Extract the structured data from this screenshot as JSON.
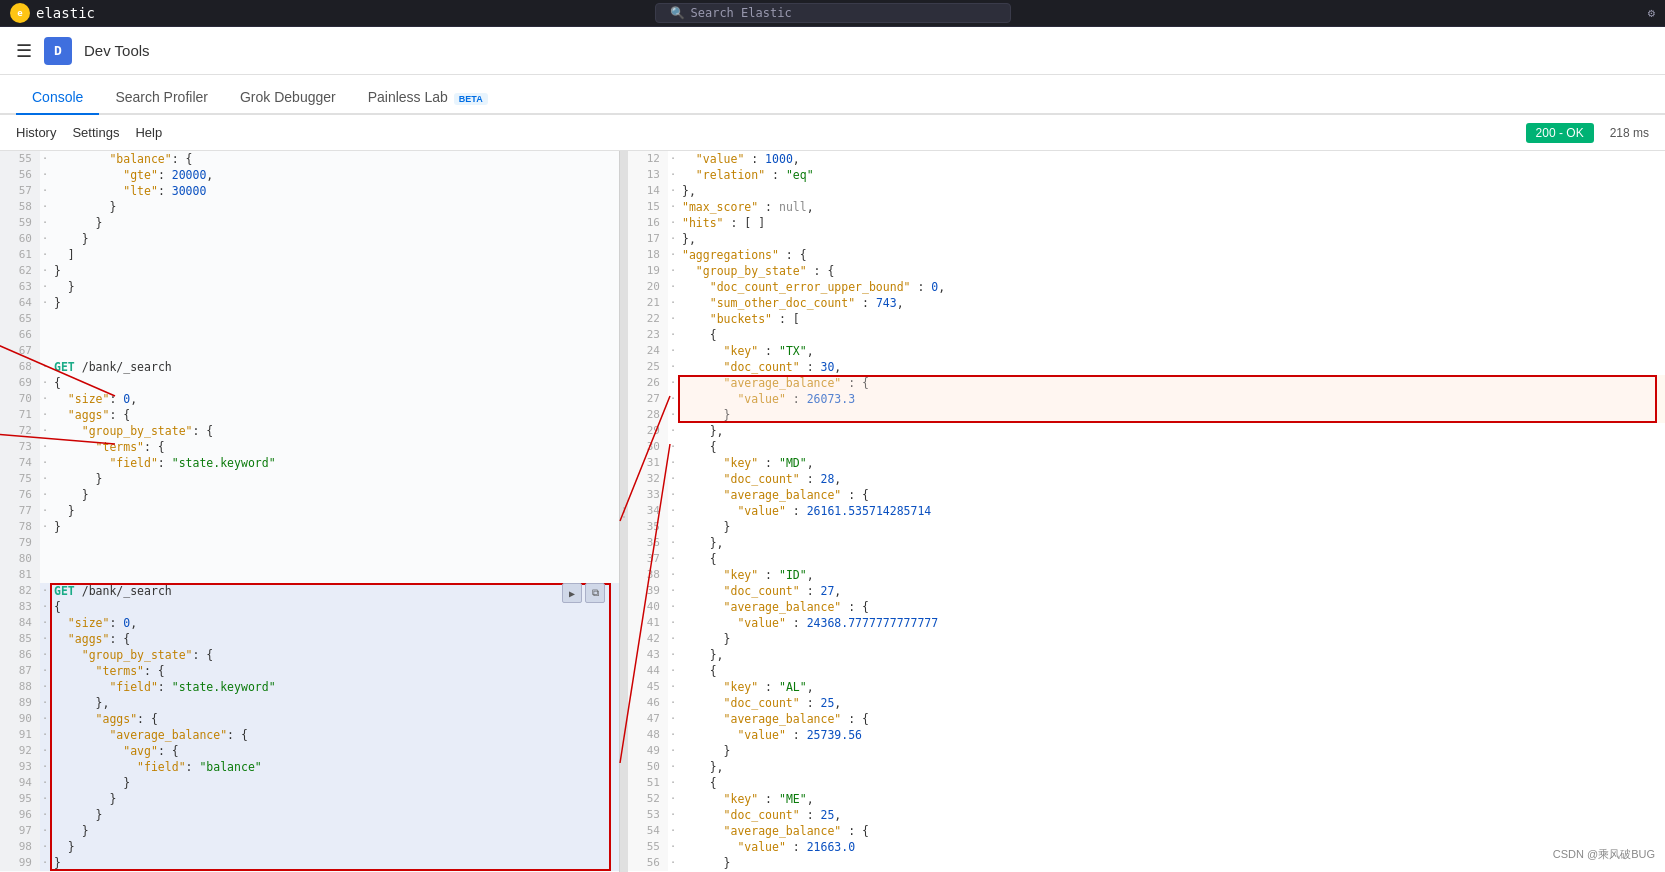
{
  "topbar": {
    "search_placeholder": "Search Elastic",
    "app_name": "elastic"
  },
  "appbar": {
    "app_icon_letter": "D",
    "app_title": "Dev Tools"
  },
  "tabs": [
    {
      "id": "console",
      "label": "Console",
      "active": true,
      "beta": false
    },
    {
      "id": "search-profiler",
      "label": "Search Profiler",
      "active": false,
      "beta": false
    },
    {
      "id": "grok-debugger",
      "label": "Grok Debugger",
      "active": false,
      "beta": false
    },
    {
      "id": "painless-lab",
      "label": "Painless Lab",
      "active": false,
      "beta": true
    }
  ],
  "menubar": {
    "history": "History",
    "settings": "Settings",
    "help": "Help",
    "status": "200 - OK",
    "size": "218 ms"
  },
  "editor": {
    "lines": [
      {
        "num": "55",
        "content": "        \"balance\": {"
      },
      {
        "num": "56",
        "content": "          \"gte\": 20000,"
      },
      {
        "num": "57",
        "content": "          \"lte\": 30000"
      },
      {
        "num": "58",
        "content": "        }"
      },
      {
        "num": "59",
        "content": "      }"
      },
      {
        "num": "60",
        "content": "    }"
      },
      {
        "num": "61",
        "content": "  ]"
      },
      {
        "num": "62",
        "content": "}"
      },
      {
        "num": "63",
        "content": "  }"
      },
      {
        "num": "64",
        "content": "}"
      },
      {
        "num": "65",
        "content": ""
      },
      {
        "num": "66",
        "content": ""
      },
      {
        "num": "67",
        "content": ""
      },
      {
        "num": "68",
        "content": "GET /bank/_search",
        "isGet": true
      },
      {
        "num": "69",
        "content": "{"
      },
      {
        "num": "70",
        "content": "  \"size\": 0,"
      },
      {
        "num": "71",
        "content": "  \"aggs\": {"
      },
      {
        "num": "72",
        "content": "    \"group_by_state\": {"
      },
      {
        "num": "73",
        "content": "      \"terms\": {"
      },
      {
        "num": "74",
        "content": "        \"field\": \"state.keyword\""
      },
      {
        "num": "75",
        "content": "      }"
      },
      {
        "num": "76",
        "content": "    }"
      },
      {
        "num": "77",
        "content": "  }"
      },
      {
        "num": "78",
        "content": "}"
      },
      {
        "num": "79",
        "content": ""
      },
      {
        "num": "80",
        "content": ""
      },
      {
        "num": "81",
        "content": ""
      },
      {
        "num": "82",
        "content": "GET /bank/_search",
        "isGet": true,
        "highlighted": true
      },
      {
        "num": "83",
        "content": "{",
        "highlighted": true
      },
      {
        "num": "84",
        "content": "  \"size\": 0,",
        "highlighted": true
      },
      {
        "num": "85",
        "content": "  \"aggs\": {",
        "highlighted": true
      },
      {
        "num": "86",
        "content": "    \"group_by_state\": {",
        "highlighted": true
      },
      {
        "num": "87",
        "content": "      \"terms\": {",
        "highlighted": true
      },
      {
        "num": "88",
        "content": "        \"field\": \"state.keyword\"",
        "highlighted": true
      },
      {
        "num": "89",
        "content": "      },",
        "highlighted": true
      },
      {
        "num": "90",
        "content": "      \"aggs\": {",
        "highlighted": true
      },
      {
        "num": "91",
        "content": "        \"average_balance\": {",
        "highlighted": true
      },
      {
        "num": "92",
        "content": "          \"avg\": {",
        "highlighted": true
      },
      {
        "num": "93",
        "content": "            \"field\": \"balance\"",
        "highlighted": true
      },
      {
        "num": "94",
        "content": "          }"
      },
      {
        "num": "95",
        "content": "        }"
      },
      {
        "num": "96",
        "content": "      }"
      },
      {
        "num": "97",
        "content": "    }"
      },
      {
        "num": "98",
        "content": "  }"
      },
      {
        "num": "99",
        "content": "}"
      }
    ]
  },
  "response": {
    "lines": [
      {
        "num": "12",
        "content": "  \"value\" : 1000,"
      },
      {
        "num": "13",
        "content": "  \"relation\" : \"eq\""
      },
      {
        "num": "14",
        "content": "},"
      },
      {
        "num": "15",
        "content": "\"max_score\" : null,"
      },
      {
        "num": "16",
        "content": "\"hits\" : [ ]"
      },
      {
        "num": "17",
        "content": "},"
      },
      {
        "num": "18",
        "content": "\"aggregations\" : {"
      },
      {
        "num": "19",
        "content": "  \"group_by_state\" : {"
      },
      {
        "num": "20",
        "content": "    \"doc_count_error_upper_bound\" : 0,"
      },
      {
        "num": "21",
        "content": "    \"sum_other_doc_count\" : 743,"
      },
      {
        "num": "22",
        "content": "    \"buckets\" : ["
      },
      {
        "num": "23",
        "content": "    {"
      },
      {
        "num": "24",
        "content": "      \"key\" : \"TX\","
      },
      {
        "num": "25",
        "content": "      \"doc_count\" : 30,"
      },
      {
        "num": "26",
        "content": "      \"average_balance\" : {",
        "highlighted": true
      },
      {
        "num": "27",
        "content": "        \"value\" : 26073.3",
        "highlighted": true
      },
      {
        "num": "28",
        "content": "      }",
        "highlighted": true
      },
      {
        "num": "29",
        "content": "    },"
      },
      {
        "num": "30",
        "content": "    {"
      },
      {
        "num": "31",
        "content": "      \"key\" : \"MD\","
      },
      {
        "num": "32",
        "content": "      \"doc_count\" : 28,"
      },
      {
        "num": "33",
        "content": "      \"average_balance\" : {"
      },
      {
        "num": "34",
        "content": "        \"value\" : 26161.535714285714"
      },
      {
        "num": "35",
        "content": "      }"
      },
      {
        "num": "36",
        "content": "    },"
      },
      {
        "num": "37",
        "content": "    {"
      },
      {
        "num": "38",
        "content": "      \"key\" : \"ID\","
      },
      {
        "num": "39",
        "content": "      \"doc_count\" : 27,"
      },
      {
        "num": "40",
        "content": "      \"average_balance\" : {"
      },
      {
        "num": "41",
        "content": "        \"value\" : 24368.7777777777777"
      },
      {
        "num": "42",
        "content": "      }"
      },
      {
        "num": "43",
        "content": "    },"
      },
      {
        "num": "44",
        "content": "    {"
      },
      {
        "num": "45",
        "content": "      \"key\" : \"AL\","
      },
      {
        "num": "46",
        "content": "      \"doc_count\" : 25,"
      },
      {
        "num": "47",
        "content": "      \"average_balance\" : {"
      },
      {
        "num": "48",
        "content": "        \"value\" : 25739.56"
      },
      {
        "num": "49",
        "content": "      }"
      },
      {
        "num": "50",
        "content": "    },"
      },
      {
        "num": "51",
        "content": "    {"
      },
      {
        "num": "52",
        "content": "      \"key\" : \"ME\","
      },
      {
        "num": "53",
        "content": "      \"doc_count\" : 25,"
      },
      {
        "num": "54",
        "content": "      \"average_balance\" : {"
      },
      {
        "num": "55",
        "content": "        \"value\" : 21663.0"
      },
      {
        "num": "56",
        "content": "      }"
      }
    ]
  },
  "watermark": "CSDN @乘风破BUG"
}
